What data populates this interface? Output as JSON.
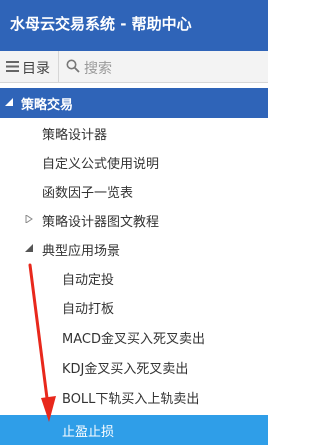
{
  "header": {
    "title": "水母云交易系统 - 帮助中心"
  },
  "toolbar": {
    "toc_label": "目录",
    "search_placeholder": "搜索"
  },
  "tree": {
    "root_label": "策略交易",
    "items": [
      {
        "label": "策略设计器"
      },
      {
        "label": "自定义公式使用说明"
      },
      {
        "label": "函数因子一览表"
      },
      {
        "label": "策略设计器图文教程"
      },
      {
        "label": "典型应用场景"
      }
    ],
    "scenarios": [
      {
        "label": "自动定投"
      },
      {
        "label": "自动打板"
      },
      {
        "label": "MACD金叉买入死叉卖出"
      },
      {
        "label": "KDJ金叉买入死叉卖出"
      },
      {
        "label": "BOLL下轨买入上轨卖出"
      },
      {
        "label": "止盈止损"
      }
    ]
  },
  "colors": {
    "header_bg": "#2f64b8",
    "selected_bg": "#2f9ee8",
    "annotation_arrow": "#e8281c"
  }
}
